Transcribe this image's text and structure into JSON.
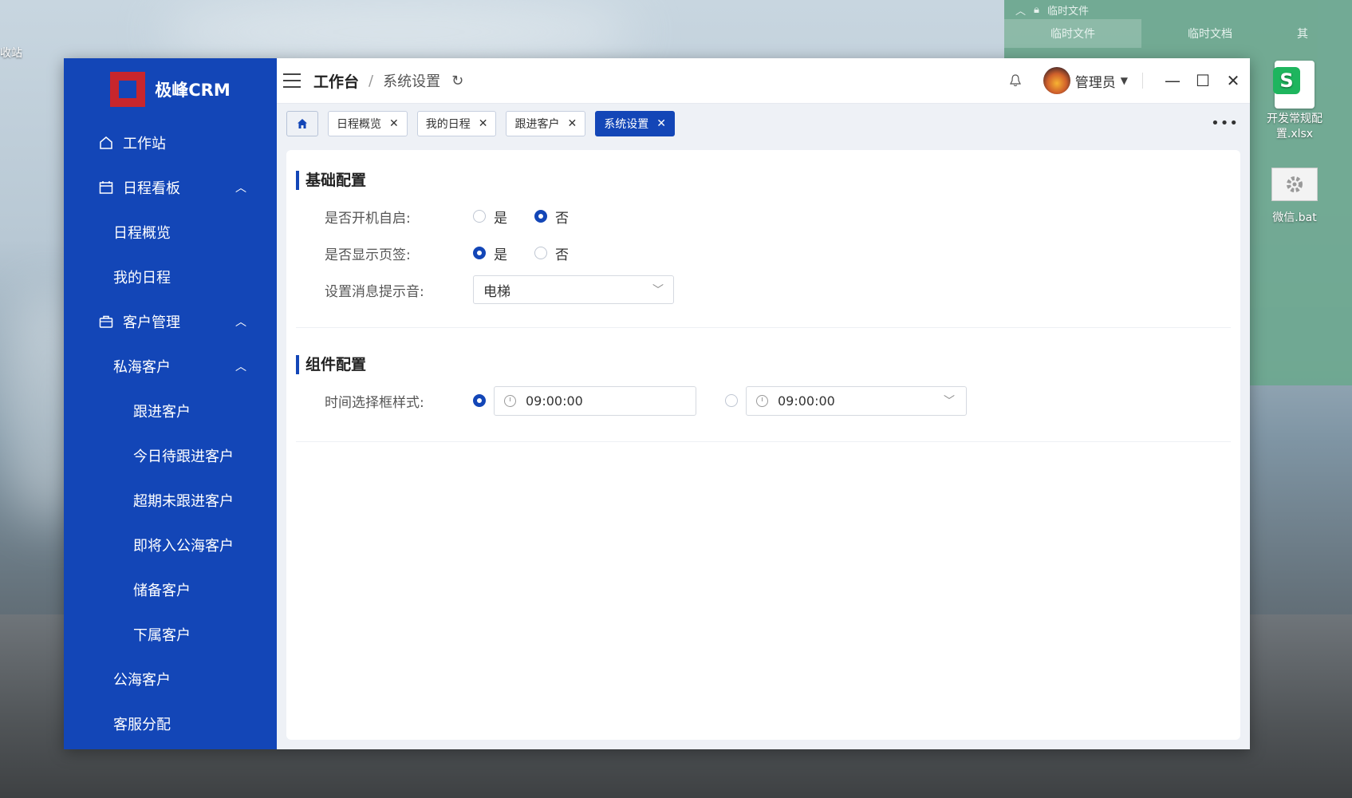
{
  "desktop": {
    "recycle_label": "收站",
    "files": [
      {
        "name": "开发常规配置.xlsx"
      },
      {
        "name": "微信.bat"
      }
    ]
  },
  "green_panel": {
    "title": "临时文件",
    "tabs": [
      {
        "label": "临时文件",
        "active": true
      },
      {
        "label": "临时文档",
        "active": false
      },
      {
        "label": "其",
        "active": false
      }
    ]
  },
  "app": {
    "logo_text": "极峰CRM",
    "sidebar": [
      {
        "label": "工作站",
        "level": 0,
        "icon": "home-icon",
        "chevron": ""
      },
      {
        "label": "日程看板",
        "level": 0,
        "icon": "calendar-icon",
        "chevron": "︿"
      },
      {
        "label": "日程概览",
        "level": 1,
        "icon": "",
        "chevron": ""
      },
      {
        "label": "我的日程",
        "level": 1,
        "icon": "",
        "chevron": ""
      },
      {
        "label": "客户管理",
        "level": 0,
        "icon": "briefcase-icon",
        "chevron": "︿"
      },
      {
        "label": "私海客户",
        "level": 1,
        "icon": "",
        "chevron": "︿"
      },
      {
        "label": "跟进客户",
        "level": 2,
        "icon": "",
        "chevron": ""
      },
      {
        "label": "今日待跟进客户",
        "level": 2,
        "icon": "",
        "chevron": ""
      },
      {
        "label": "超期未跟进客户",
        "level": 2,
        "icon": "",
        "chevron": ""
      },
      {
        "label": "即将入公海客户",
        "level": 2,
        "icon": "",
        "chevron": ""
      },
      {
        "label": "储备客户",
        "level": 2,
        "icon": "",
        "chevron": ""
      },
      {
        "label": "下属客户",
        "level": 2,
        "icon": "",
        "chevron": ""
      },
      {
        "label": "公海客户",
        "level": 1,
        "icon": "",
        "chevron": ""
      },
      {
        "label": "客服分配",
        "level": 1,
        "icon": "",
        "chevron": ""
      }
    ],
    "breadcrumb": {
      "root": "工作台",
      "sep": "/",
      "current": "系统设置"
    },
    "user": {
      "name": "管理员"
    },
    "tabs": [
      {
        "label": "日程概览",
        "active": false
      },
      {
        "label": "我的日程",
        "active": false
      },
      {
        "label": "跟进客户",
        "active": false
      },
      {
        "label": "系统设置",
        "active": true
      }
    ],
    "settings": {
      "basic": {
        "title": "基础配置",
        "autostart": {
          "label": "是否开机自启:",
          "yes": "是",
          "no": "否",
          "value": "否"
        },
        "show_tabs": {
          "label": "是否显示页签:",
          "yes": "是",
          "no": "否",
          "value": "是"
        },
        "sound": {
          "label": "设置消息提示音:",
          "value": "电梯"
        }
      },
      "component": {
        "title": "组件配置",
        "time_picker": {
          "label": "时间选择框样式:",
          "option1_value": "09:00:00",
          "option2_value": "09:00:00",
          "selected": 1
        }
      }
    }
  }
}
